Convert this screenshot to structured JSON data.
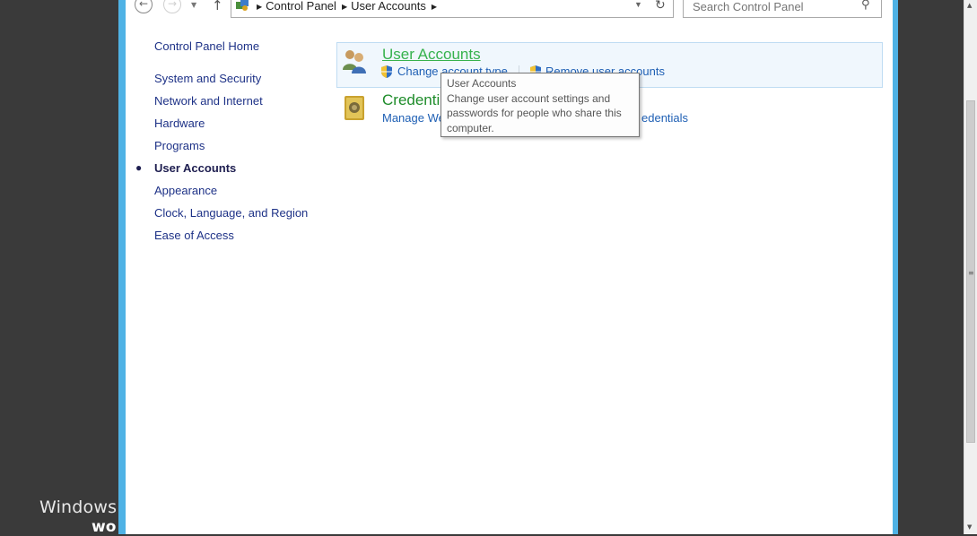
{
  "desktop": {
    "watermark_line1": "Windows",
    "watermark_line2": "wo"
  },
  "navigation": {
    "back_icon": "back-arrow-icon",
    "forward_icon": "forward-arrow-icon",
    "recent_icon": "chevron-down-icon",
    "up_icon": "up-arrow-icon"
  },
  "address_bar": {
    "crumbs": [
      "Control Panel",
      "User Accounts"
    ],
    "refresh_icon": "refresh-icon"
  },
  "search": {
    "placeholder": "Search Control Panel"
  },
  "sidebar": {
    "home": "Control Panel Home",
    "items": [
      {
        "label": "System and Security"
      },
      {
        "label": "Network and Internet"
      },
      {
        "label": "Hardware"
      },
      {
        "label": "Programs"
      },
      {
        "label": "User Accounts",
        "current": true
      },
      {
        "label": "Appearance"
      },
      {
        "label": "Clock, Language, and Region"
      },
      {
        "label": "Ease of Access"
      }
    ]
  },
  "categories": [
    {
      "title": "User Accounts",
      "links": [
        "Change account type",
        "Remove user accounts"
      ]
    },
    {
      "title": "Credenti",
      "links": [
        "Manage We",
        "edentials"
      ]
    }
  ],
  "tooltip": {
    "title": "User Accounts",
    "body_line1": "Change user account settings and",
    "body_line2": "passwords for people who share this",
    "body_line3": "computer."
  },
  "colors": {
    "window_border": "#4fb2e5",
    "link": "#1e5fb4",
    "category_title": "#1e8c2a",
    "sidebar_link": "#1e3287"
  }
}
